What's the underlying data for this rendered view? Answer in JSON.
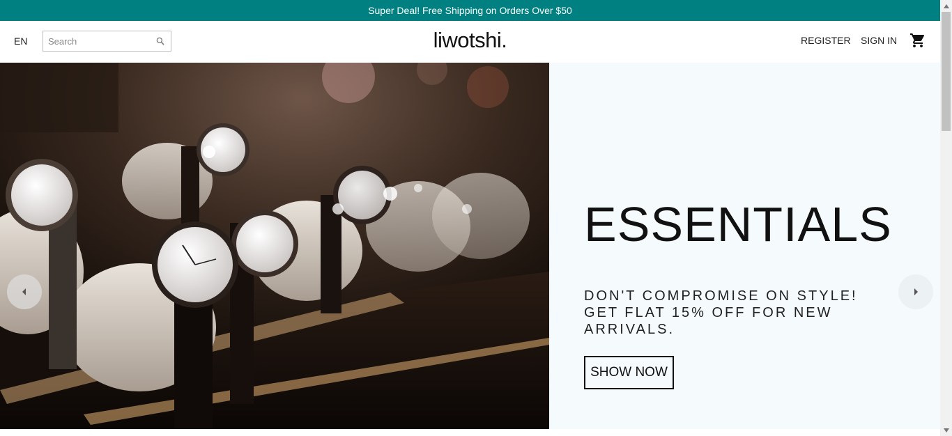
{
  "announcement": {
    "text": "Super Deal! Free Shipping on Orders Over $50"
  },
  "header": {
    "language": "EN",
    "search": {
      "placeholder": "Search",
      "value": ""
    },
    "logo": "liwotshi.",
    "nav": {
      "register": "REGISTER",
      "sign_in": "SIGN IN"
    }
  },
  "slide": {
    "title": "ESSENTIALS",
    "description": "DON'T COMPROMISE ON STYLE! GET FLAT 15% OFF FOR NEW ARRIVALS.",
    "button": "SHOW NOW"
  },
  "colors": {
    "announcement_bg": "#008080",
    "slide_bg": "#f5fafd",
    "text": "#111111"
  },
  "icons": {
    "search": "search-icon",
    "cart": "shopping-cart-icon",
    "prev": "arrow-left-icon",
    "next": "arrow-right-icon"
  }
}
